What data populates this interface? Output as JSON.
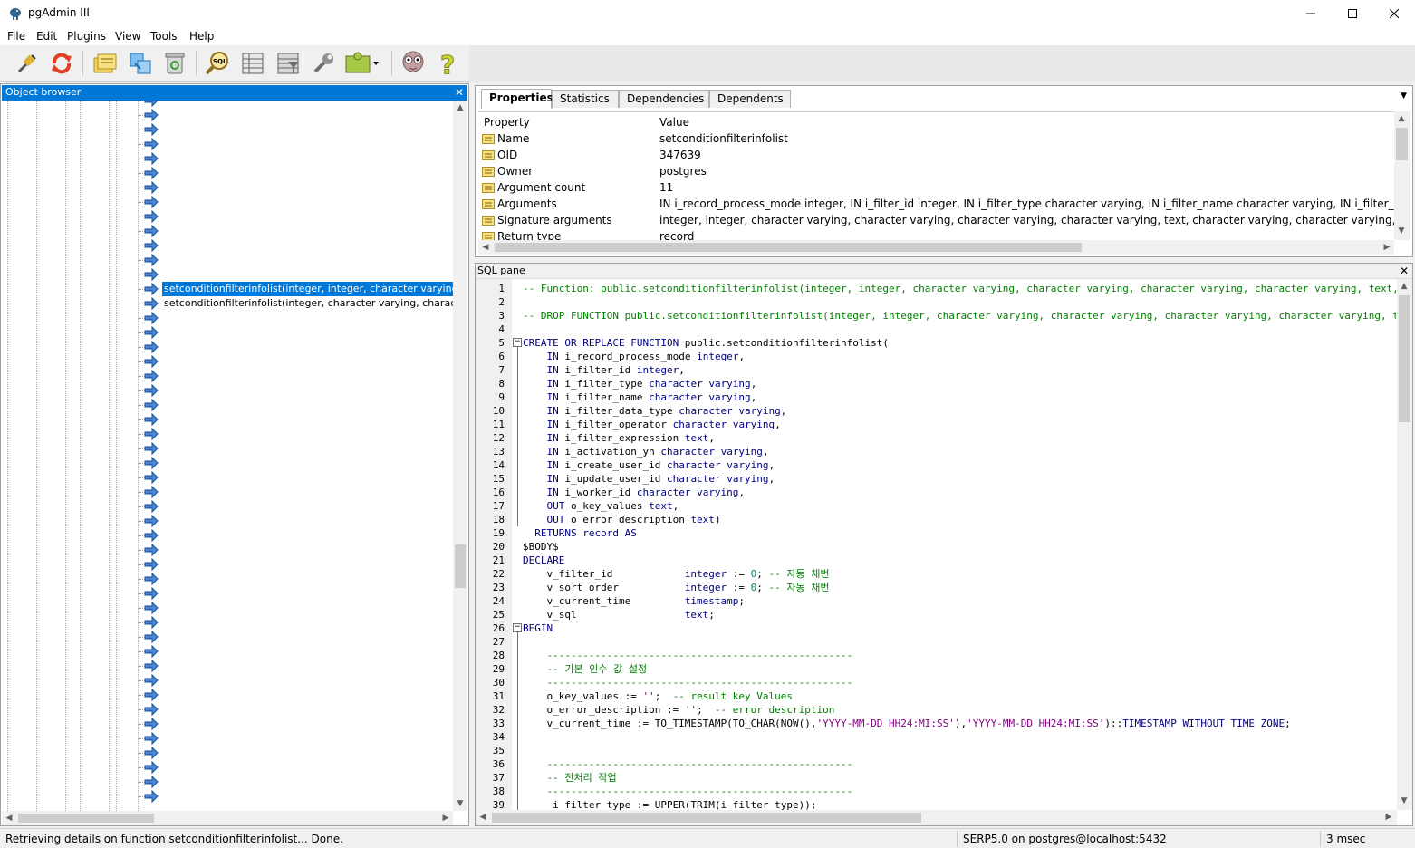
{
  "window": {
    "title": "pgAdmin III"
  },
  "menu": [
    "File",
    "Edit",
    "Plugins",
    "View",
    "Tools",
    "Help"
  ],
  "toolbar_icons": [
    "connect-icon",
    "refresh-icon",
    "properties-icon",
    "create-icon",
    "drop-icon",
    "sql-query-icon",
    "view-data-icon",
    "filtered-data-icon",
    "maintenance-icon",
    "plugins-icon",
    "hint-icon",
    "help-icon"
  ],
  "object_browser": {
    "title": "Object browser",
    "close": "✕",
    "selected": "setconditionfilterinfolist(integer, integer, character varying,",
    "second": "setconditionfilterinfolist(integer, character varying, characte"
  },
  "properties": {
    "tabs": [
      "Properties",
      "Statistics",
      "Dependencies",
      "Dependents"
    ],
    "headers": {
      "property": "Property",
      "value": "Value"
    },
    "rows": [
      {
        "name": "Name",
        "value": "setconditionfilterinfolist"
      },
      {
        "name": "OID",
        "value": "347639"
      },
      {
        "name": "Owner",
        "value": "postgres"
      },
      {
        "name": "Argument count",
        "value": "11"
      },
      {
        "name": "Arguments",
        "value": "IN i_record_process_mode integer, IN i_filter_id integer, IN i_filter_type character varying, IN i_filter_name character varying, IN i_filter_data_type c"
      },
      {
        "name": "Signature arguments",
        "value": "integer, integer, character varying, character varying, character varying, character varying, text, character varying, character varying, character varyi"
      },
      {
        "name": "Return type",
        "value": "record"
      }
    ]
  },
  "sql_pane": {
    "title": "SQL pane",
    "close": "✕",
    "lines": [
      [
        [
          "c",
          "-- Function: public.setconditionfilterinfolist(integer, integer, character varying, character varying, character varying, character varying, text,"
        ]
      ],
      [
        [
          "",
          ""
        ]
      ],
      [
        [
          "c",
          "-- DROP FUNCTION public.setconditionfilterinfolist(integer, integer, character varying, character varying, character varying, character varying, text,"
        ]
      ],
      [
        [
          "",
          ""
        ]
      ],
      [
        [
          "k",
          "CREATE OR REPLACE FUNCTION"
        ],
        [
          "",
          " public.setconditionfilterinfolist("
        ]
      ],
      [
        [
          "k",
          "    IN"
        ],
        [
          "",
          " i_record_process_mode "
        ],
        [
          "k",
          "integer"
        ],
        [
          "",
          ","
        ]
      ],
      [
        [
          "k",
          "    IN"
        ],
        [
          "",
          " i_filter_id "
        ],
        [
          "k",
          "integer"
        ],
        [
          "",
          ","
        ]
      ],
      [
        [
          "k",
          "    IN"
        ],
        [
          "",
          " i_filter_type "
        ],
        [
          "k",
          "character varying"
        ],
        [
          "",
          ","
        ]
      ],
      [
        [
          "k",
          "    IN"
        ],
        [
          "",
          " i_filter_name "
        ],
        [
          "k",
          "character varying"
        ],
        [
          "",
          ","
        ]
      ],
      [
        [
          "k",
          "    IN"
        ],
        [
          "",
          " i_filter_data_type "
        ],
        [
          "k",
          "character varying"
        ],
        [
          "",
          ","
        ]
      ],
      [
        [
          "k",
          "    IN"
        ],
        [
          "",
          " i_filter_operator "
        ],
        [
          "k",
          "character varying"
        ],
        [
          "",
          ","
        ]
      ],
      [
        [
          "k",
          "    IN"
        ],
        [
          "",
          " i_filter_expression "
        ],
        [
          "k",
          "text"
        ],
        [
          "",
          ","
        ]
      ],
      [
        [
          "k",
          "    IN"
        ],
        [
          "",
          " i_activation_yn "
        ],
        [
          "k",
          "character varying"
        ],
        [
          "",
          ","
        ]
      ],
      [
        [
          "k",
          "    IN"
        ],
        [
          "",
          " i_create_user_id "
        ],
        [
          "k",
          "character varying"
        ],
        [
          "",
          ","
        ]
      ],
      [
        [
          "k",
          "    IN"
        ],
        [
          "",
          " i_update_user_id "
        ],
        [
          "k",
          "character varying"
        ],
        [
          "",
          ","
        ]
      ],
      [
        [
          "k",
          "    IN"
        ],
        [
          "",
          " i_worker_id "
        ],
        [
          "k",
          "character varying"
        ],
        [
          "",
          ","
        ]
      ],
      [
        [
          "k",
          "    OUT"
        ],
        [
          "",
          " o_key_values "
        ],
        [
          "k",
          "text"
        ],
        [
          "",
          ","
        ]
      ],
      [
        [
          "k",
          "    OUT"
        ],
        [
          "",
          " o_error_description "
        ],
        [
          "k",
          "text"
        ],
        [
          "",
          ")"
        ]
      ],
      [
        [
          "k",
          "  RETURNS"
        ],
        [
          "",
          " "
        ],
        [
          "k",
          "record"
        ],
        [
          "",
          " "
        ],
        [
          "k",
          "AS"
        ]
      ],
      [
        [
          "",
          "$BODY$"
        ]
      ],
      [
        [
          "k",
          "DECLARE"
        ]
      ],
      [
        [
          "",
          "    v_filter_id            "
        ],
        [
          "k",
          "integer"
        ],
        [
          "",
          " := "
        ],
        [
          "n",
          "0"
        ],
        [
          "",
          "; "
        ],
        [
          "c",
          "-- 자동 채번"
        ]
      ],
      [
        [
          "",
          "    v_sort_order           "
        ],
        [
          "k",
          "integer"
        ],
        [
          "",
          " := "
        ],
        [
          "n",
          "0"
        ],
        [
          "",
          "; "
        ],
        [
          "c",
          "-- 자동 채번"
        ]
      ],
      [
        [
          "",
          "    v_current_time         "
        ],
        [
          "k",
          "timestamp"
        ],
        [
          "",
          ";"
        ]
      ],
      [
        [
          "",
          "    v_sql                  "
        ],
        [
          "k",
          "text"
        ],
        [
          "",
          ";"
        ]
      ],
      [
        [
          "k",
          "BEGIN"
        ]
      ],
      [
        [
          "",
          ""
        ]
      ],
      [
        [
          "c",
          "    ---------------------------------------------------"
        ]
      ],
      [
        [
          "c",
          "    -- 기본 인수 값 설정"
        ]
      ],
      [
        [
          "c",
          "    ---------------------------------------------------"
        ]
      ],
      [
        [
          "",
          "    o_key_values := "
        ],
        [
          "s",
          "''"
        ],
        [
          "",
          ";  "
        ],
        [
          "c",
          "-- result key Values"
        ]
      ],
      [
        [
          "",
          "    o_error_description := "
        ],
        [
          "s",
          "''"
        ],
        [
          "",
          ";  "
        ],
        [
          "c",
          "-- error description"
        ]
      ],
      [
        [
          "",
          "    v_current_time := TO_TIMESTAMP(TO_CHAR(NOW(),"
        ],
        [
          "s",
          "'YYYY-MM-DD HH24:MI:SS'"
        ],
        [
          "",
          "),"
        ],
        [
          "s",
          "'YYYY-MM-DD HH24:MI:SS'"
        ],
        [
          "",
          ")::"
        ],
        [
          "k",
          "TIMESTAMP WITHOUT TIME ZONE"
        ],
        [
          "",
          ";"
        ]
      ],
      [
        [
          "",
          ""
        ]
      ],
      [
        [
          "",
          ""
        ]
      ],
      [
        [
          "c",
          "    ---------------------------------------------------"
        ]
      ],
      [
        [
          "c",
          "    -- 전처리 작업"
        ]
      ],
      [
        [
          "c",
          "    ---------------------------------------------------"
        ]
      ],
      [
        [
          "",
          "     i_filter_type := UPPER(TRIM(i_filter_type));"
        ]
      ]
    ]
  },
  "status": {
    "message": "Retrieving details on function setconditionfilterinfolist... Done.",
    "connection": "SERP5.0 on postgres@localhost:5432",
    "time": "3 msec"
  }
}
